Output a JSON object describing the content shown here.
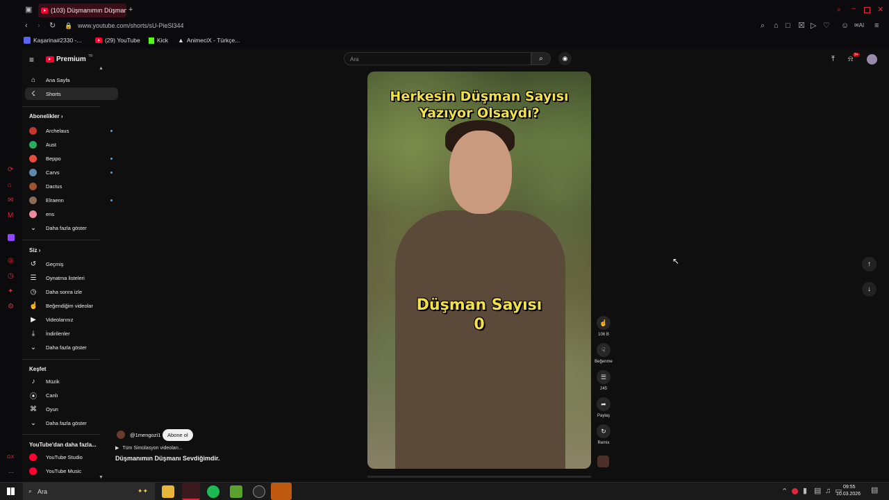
{
  "browser": {
    "tab_title": "(103) Düşmanımın Düşman",
    "address": "www.youtube.com/shorts/sU-PieSl344",
    "ai_label": "AI",
    "bookmarks": [
      "Kaşarina#2330 -...",
      "(29) YouTube",
      "Kick",
      "AnimeciX - Türkçe..."
    ]
  },
  "youtube": {
    "logo_text": "Premium",
    "logo_region": "TR",
    "search_placeholder": "Ara",
    "notif_count": "9+",
    "sidebar": {
      "main": [
        {
          "label": "Ana Sayfa",
          "icon": "home-icon"
        },
        {
          "label": "Shorts",
          "icon": "shorts-icon"
        }
      ],
      "subs_header": "Abonelikler",
      "subs": [
        {
          "label": "Archelaus",
          "color": "#c0392b",
          "new": true
        },
        {
          "label": "Aust",
          "color": "#27ae60",
          "new": false
        },
        {
          "label": "Beppo",
          "color": "#e74c3c",
          "new": true
        },
        {
          "label": "Carvs",
          "color": "#5d8aa8",
          "new": true
        },
        {
          "label": "Dactus",
          "color": "#a0522d",
          "new": false
        },
        {
          "label": "Elraenn",
          "color": "#8e6c5a",
          "new": true
        },
        {
          "label": "ens",
          "color": "#e88b9e",
          "new": false
        }
      ],
      "subs_more": "Daha fazla göster",
      "you_header": "Siz",
      "you": [
        {
          "label": "Geçmiş",
          "icon": "history-icon"
        },
        {
          "label": "Oynatma listeleri",
          "icon": "playlist-icon"
        },
        {
          "label": "Daha sonra izle",
          "icon": "clock-icon"
        },
        {
          "label": "Beğendiğim videolar",
          "icon": "like-icon"
        },
        {
          "label": "Videolarınız",
          "icon": "video-icon"
        },
        {
          "label": "İndirilenler",
          "icon": "download-icon"
        }
      ],
      "you_more": "Daha fazla göster",
      "explore_header": "Keşfet",
      "explore": [
        {
          "label": "Müzik",
          "icon": "music-icon"
        },
        {
          "label": "Canlı",
          "icon": "live-icon"
        },
        {
          "label": "Oyun",
          "icon": "game-icon"
        }
      ],
      "explore_more": "Daha fazla göster",
      "more_header": "YouTube'dan daha fazla...",
      "more": [
        {
          "label": "YouTube Studio"
        },
        {
          "label": "YouTube Music"
        }
      ]
    },
    "short": {
      "top_text_1": "Herkesin Düşman Sayısı",
      "top_text_2": "Yazıyor Olsaydı?",
      "mid_text_1": "Düşman Sayısı",
      "mid_text_2": "0",
      "channel": "@1mengozi1",
      "subscribe": "Abone ol",
      "playlist": "Tüm Simülasyon videoları...",
      "title": "Düşmanımın Düşmanı Sevdiğimdir."
    },
    "actions": {
      "likes": "106 B",
      "dislike": "Beğenme",
      "comments": "245",
      "share": "Paylaş",
      "remix": "Remix"
    }
  },
  "taskbar": {
    "search": "Ara",
    "time": "09:55",
    "date": "10.03.2026"
  }
}
